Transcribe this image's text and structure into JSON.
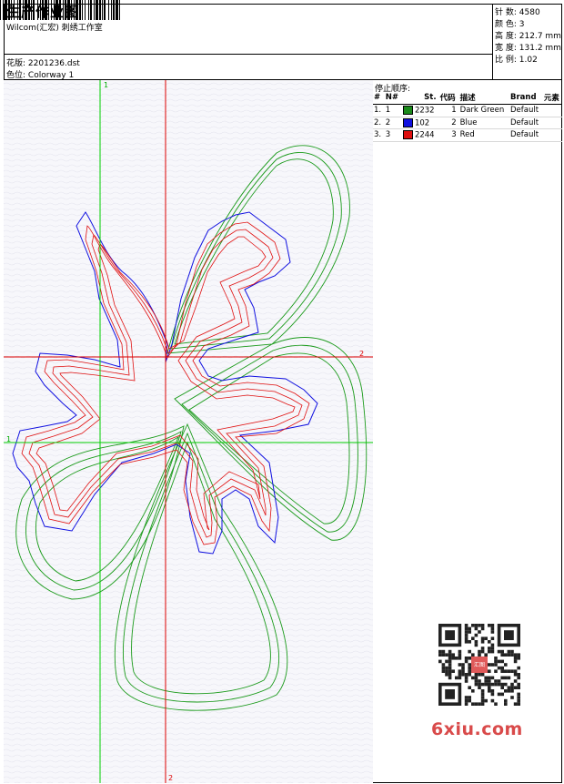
{
  "header": {
    "title": "生产作业图",
    "company": "Wilcom(汇宏) 刺绣工作室",
    "design_label": "花版:",
    "design_name": "2201236.dst",
    "colorway_label": "色位:",
    "colorway_name": "Colorway 1"
  },
  "stats": [
    {
      "label": "针 数:",
      "value": "4580"
    },
    {
      "label": "颜 色:",
      "value": "3"
    },
    {
      "label": "高 度:",
      "value": "212.7 mm"
    },
    {
      "label": "宽 度:",
      "value": "131.2 mm"
    },
    {
      "label": "比 例:",
      "value": "1.02"
    }
  ],
  "stop_sequence": {
    "title": "停止顺序:",
    "columns": [
      "#",
      "N#",
      "St.",
      "代码",
      "描述",
      "Brand",
      "元素"
    ],
    "rows": [
      {
        "idx": "1.",
        "n": "1",
        "st": "2232",
        "code": "1",
        "desc": "Dark Green",
        "brand": "Default",
        "color": "#1a8a1a"
      },
      {
        "idx": "2.",
        "n": "2",
        "st": "102",
        "code": "2",
        "desc": "Blue",
        "brand": "Default",
        "color": "#1010e0"
      },
      {
        "idx": "3.",
        "n": "3",
        "st": "2244",
        "code": "3",
        "desc": "Red",
        "brand": "Default",
        "color": "#e01010"
      }
    ]
  },
  "axes": {
    "v_green": "1",
    "h_green": "1",
    "v_red": "2",
    "h_red": "2"
  },
  "colors": {
    "green": "#1a9a1a",
    "blue": "#1010e0",
    "red": "#e01010",
    "guide_green": "#00cc00",
    "guide_red": "#dd0000"
  },
  "watermark": {
    "text": "6xiu.com",
    "stamp": "汇图"
  }
}
